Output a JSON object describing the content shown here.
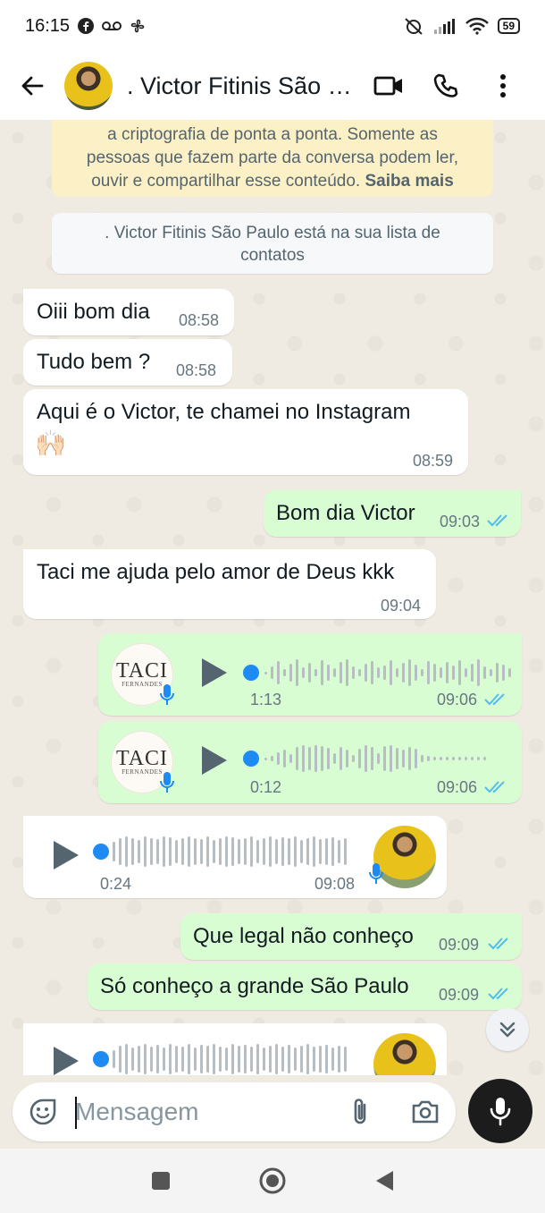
{
  "status_bar": {
    "time": "16:15",
    "battery": "59"
  },
  "header": {
    "contact_name": ". Victor Fitinis São Paulo"
  },
  "system": {
    "encryption_text_line1": "a criptografia de ponta a ponta. Somente as",
    "encryption_text_line2": "pessoas que fazem parte da conversa podem ler,",
    "encryption_text_line3": "ouvir e compartilhar esse conteúdo.",
    "learn_more": "Saiba mais",
    "contact_notice_line1": ". Victor Fitinis São Paulo está na sua lista de",
    "contact_notice_line2": "contatos"
  },
  "messages": [
    {
      "direction": "in",
      "text": "Oiii bom dia",
      "time": "08:58"
    },
    {
      "direction": "in",
      "text": "Tudo bem ?",
      "time": "08:58"
    },
    {
      "direction": "in",
      "text": "Aqui é o Victor, te chamei no Instagram",
      "emoji": "🙌🏻",
      "time": "08:59"
    },
    {
      "direction": "out",
      "text": "Bom dia Victor",
      "time": "09:03",
      "status": "read"
    },
    {
      "direction": "in",
      "text": "Taci me ajuda pelo amor de Deus kkk",
      "time": "09:04"
    },
    {
      "direction": "out",
      "type": "voice",
      "duration": "1:13",
      "time": "09:06",
      "status": "read",
      "avatar_text": "TACI",
      "avatar_sub": "FERNANDES"
    },
    {
      "direction": "out",
      "type": "voice",
      "duration": "0:12",
      "time": "09:06",
      "status": "read",
      "avatar_text": "TACI",
      "avatar_sub": "FERNANDES"
    },
    {
      "direction": "in",
      "type": "voice",
      "duration": "0:24",
      "time": "09:08"
    },
    {
      "direction": "out",
      "text": "Que legal não conheço",
      "time": "09:09",
      "status": "read"
    },
    {
      "direction": "out",
      "text": "Só conheço a grande São Paulo",
      "time": "09:09",
      "status": "read"
    },
    {
      "direction": "in",
      "type": "voice",
      "duration": "",
      "time": ""
    }
  ],
  "composer": {
    "placeholder": "Mensagem"
  },
  "colors": {
    "incoming_bubble": "#ffffff",
    "outgoing_bubble": "#d9fdd3",
    "read_ticks": "#53bdeb",
    "voice_dot": "#1d8bf1",
    "chat_background": "#efeae2"
  },
  "icons": [
    "back-arrow-icon",
    "video-call-icon",
    "phone-icon",
    "more-vert-icon",
    "sticker-icon",
    "attach-icon",
    "camera-icon",
    "mic-icon",
    "play-icon",
    "double-chevron-down-icon"
  ]
}
